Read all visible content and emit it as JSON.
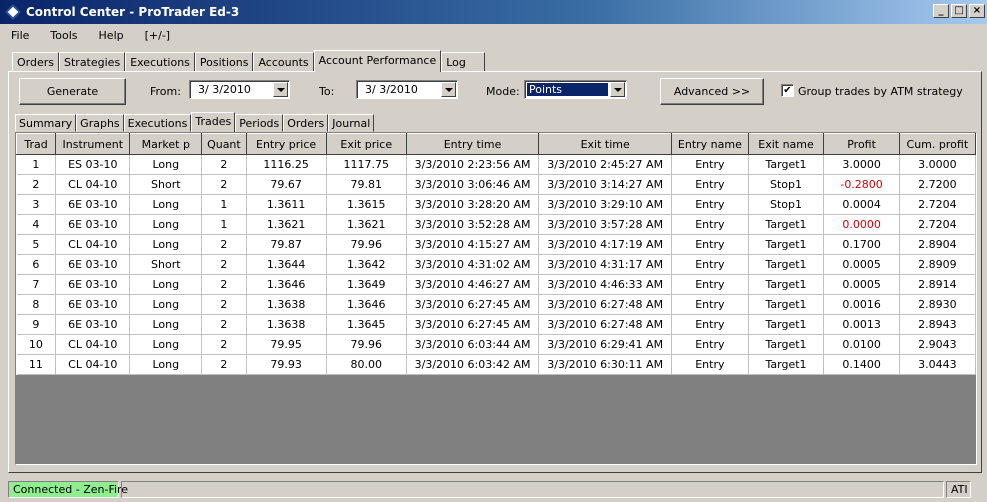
{
  "window": {
    "title": "Control Center - ProTrader Ed-3",
    "buttons": {
      "minimize": "_",
      "maximize": "□",
      "close": "×"
    }
  },
  "menu": [
    "File",
    "Tools",
    "Help",
    "[+/-]"
  ],
  "main_tabs": [
    "Orders",
    "Strategies",
    "Executions",
    "Positions",
    "Accounts",
    "Account Performance",
    "Log"
  ],
  "active_main_tab": "Account Performance",
  "controls": {
    "generate_label": "Generate",
    "from_label": "From:",
    "from_value": "3/  3/2010",
    "to_label": "To:",
    "to_value": "3/  3/2010",
    "mode_label": "Mode:",
    "mode_value": "Points",
    "advanced_label": "Advanced >>",
    "group_checkbox_label": "Group trades by ATM strategy",
    "group_checked": true,
    "check_mark": "✔"
  },
  "sub_tabs": [
    "Summary",
    "Graphs",
    "Executions",
    "Trades",
    "Periods",
    "Orders",
    "Journal"
  ],
  "active_sub_tab": "Trades",
  "table": {
    "columns": [
      "Trad",
      "Instrument",
      "Market p",
      "Quant",
      "Entry price",
      "Exit price",
      "Entry time",
      "Exit time",
      "Entry name",
      "Exit name",
      "Profit",
      "Cum. profit"
    ],
    "rows": [
      [
        "1",
        "ES 03-10",
        "Long",
        "2",
        "1116.25",
        "1117.75",
        "3/3/2010 2:23:56 AM",
        "3/3/2010 2:45:27 AM",
        "Entry",
        "Target1",
        "3.0000",
        "3.0000"
      ],
      [
        "2",
        "CL 04-10",
        "Short",
        "2",
        "79.67",
        "79.81",
        "3/3/2010 3:06:46 AM",
        "3/3/2010 3:14:27 AM",
        "Entry",
        "Stop1",
        "-0.2800",
        "2.7200"
      ],
      [
        "3",
        "6E 03-10",
        "Long",
        "1",
        "1.3611",
        "1.3615",
        "3/3/2010 3:28:20 AM",
        "3/3/2010 3:29:10 AM",
        "Entry",
        "Stop1",
        "0.0004",
        "2.7204"
      ],
      [
        "4",
        "6E 03-10",
        "Long",
        "1",
        "1.3621",
        "1.3621",
        "3/3/2010 3:52:28 AM",
        "3/3/2010 3:57:28 AM",
        "Entry",
        "Target1",
        "0.0000",
        "2.7204"
      ],
      [
        "5",
        "CL 04-10",
        "Long",
        "2",
        "79.87",
        "79.96",
        "3/3/2010 4:15:27 AM",
        "3/3/2010 4:17:19 AM",
        "Entry",
        "Target1",
        "0.1700",
        "2.8904"
      ],
      [
        "6",
        "6E 03-10",
        "Short",
        "2",
        "1.3644",
        "1.3642",
        "3/3/2010 4:31:02 AM",
        "3/3/2010 4:31:17 AM",
        "Entry",
        "Target1",
        "0.0005",
        "2.8909"
      ],
      [
        "7",
        "6E 03-10",
        "Long",
        "2",
        "1.3646",
        "1.3649",
        "3/3/2010 4:46:27 AM",
        "3/3/2010 4:46:33 AM",
        "Entry",
        "Target1",
        "0.0005",
        "2.8914"
      ],
      [
        "8",
        "6E 03-10",
        "Long",
        "2",
        "1.3638",
        "1.3646",
        "3/3/2010 6:27:45 AM",
        "3/3/2010 6:27:48 AM",
        "Entry",
        "Target1",
        "0.0016",
        "2.8930"
      ],
      [
        "9",
        "6E 03-10",
        "Long",
        "2",
        "1.3638",
        "1.3645",
        "3/3/2010 6:27:45 AM",
        "3/3/2010 6:27:48 AM",
        "Entry",
        "Target1",
        "0.0013",
        "2.8943"
      ],
      [
        "10",
        "CL 04-10",
        "Long",
        "2",
        "79.95",
        "79.96",
        "3/3/2010 6:03:44 AM",
        "3/3/2010 6:29:41 AM",
        "Entry",
        "Target1",
        "0.0100",
        "2.9043"
      ],
      [
        "11",
        "CL 04-10",
        "Long",
        "2",
        "79.93",
        "80.00",
        "3/3/2010 6:03:42 AM",
        "3/3/2010 6:30:11 AM",
        "Entry",
        "Target1",
        "0.1400",
        "3.0443"
      ]
    ],
    "red_profit_rows": [
      1,
      3
    ]
  },
  "status": {
    "connection": "Connected - Zen-Fire",
    "right": "ATI"
  },
  "colors": {
    "title_gradient_start": "#0a246a",
    "mode_selected_bg": "#0a246a",
    "negative_profit": "#d40000",
    "connected_bg": "#90ee90"
  }
}
